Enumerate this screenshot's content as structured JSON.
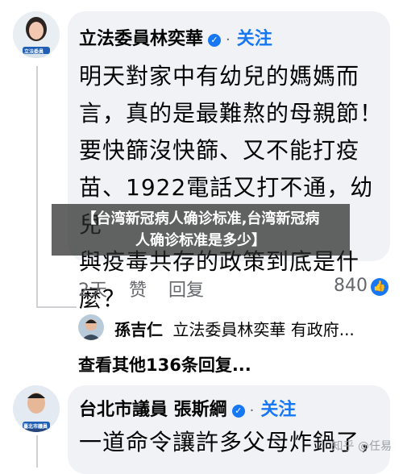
{
  "comment1": {
    "avatar_label": "立法委員",
    "author": "立法委員林奕華",
    "follow_label": "关注",
    "text_lines": [
      "明天對家中有幼兒的媽媽而",
      "言，真的是最難熬的母親節！",
      "要快篩沒快篩、又不能打疫",
      "苗、1922電話又打不通，幼兒",
      "與疫毒共存的政策到底是什",
      "麼？"
    ],
    "time": "2天",
    "like_label": "赞",
    "reply_label": "回复",
    "reaction_count": "840"
  },
  "overlay": {
    "title_line1": "【台湾新冠病人确诊标准,台湾新冠病",
    "title_line2": "人确诊标准是多少】"
  },
  "reply_preview": {
    "author": "孫吉仁",
    "text": "立法委員林奕華 有政府..."
  },
  "view_more_label": "查看其他136条回复...",
  "comment2": {
    "avatar_label": "臺北市議員",
    "author": "台北市議員 張斯綱",
    "follow_label": "关注",
    "text_line": "一道命令讓許多父母炸鍋了，"
  },
  "watermark": "知乎 @任易",
  "colors": {
    "accent": "#1877f2",
    "bubble": "#f0f2f5",
    "muted": "#65676b"
  }
}
